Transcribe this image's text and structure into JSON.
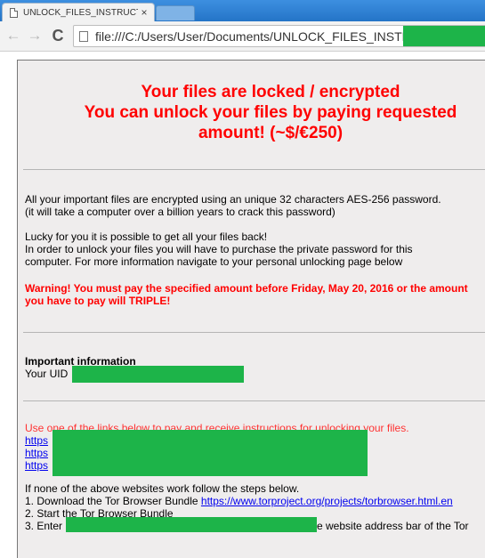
{
  "browser": {
    "tab_title": "UNLOCK_FILES_INSTRUCT",
    "tab_close": "×",
    "url": "file:///C:/Users/User/Documents/UNLOCK_FILES_INSTRU",
    "back_glyph": "←",
    "forward_glyph": "→",
    "reload_glyph": "C"
  },
  "note": {
    "headline_1": "Your files are locked / encrypted",
    "headline_2": "You can unlock your files by paying requested",
    "headline_3": "amount! (~$/€250)",
    "p1_line1": "All your important files are encrypted using an unique 32 characters AES-256 password.",
    "p1_line2": "(it will take a computer over a billion years to crack this password)",
    "p2_line1": "Lucky for you it is possible to get all your files back!",
    "p2_line2": "In order to unlock your files you will have to purchase the private password for this",
    "p2_line3": "computer. For more information navigate to your personal unlocking page below",
    "warning": "Warning! You must pay the specified amount before Friday, May 20, 2016 or the amount you have to pay will TRIPLE!",
    "important_heading": "Important information",
    "uid_label": "Your UID",
    "links_intro": "Use one of the links below to pay and receive instructions for unlocking your files.",
    "links": [
      "https",
      "https",
      "https"
    ],
    "steps_intro": "If none of the above websites work follow the steps below.",
    "step1_prefix": "1. Download the Tor Browser Bundle ",
    "step1_link": "https://www.torproject.org/projects/torbrowser.html.en",
    "step2": "2. Start the Tor Browser Bundle",
    "step3_prefix": "3. Enter",
    "step3_suffix": "e website address bar of the Tor"
  },
  "colors": {
    "alert_red": "#ff0000",
    "redaction_green": "#1db449",
    "link_blue": "#0000ee",
    "tab_bar_blue": "#2a7fd4"
  },
  "icons": [
    "document-icon",
    "close-icon",
    "back-arrow-icon",
    "forward-arrow-icon",
    "reload-icon",
    "page-icon"
  ]
}
